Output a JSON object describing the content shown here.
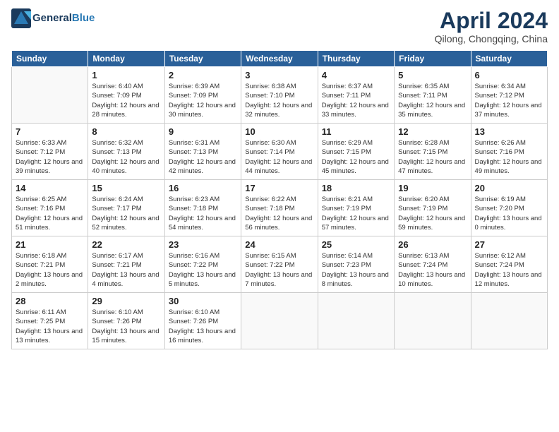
{
  "header": {
    "logo_line1": "General",
    "logo_line2": "Blue",
    "title": "April 2024",
    "subtitle": "Qilong, Chongqing, China"
  },
  "weekdays": [
    "Sunday",
    "Monday",
    "Tuesday",
    "Wednesday",
    "Thursday",
    "Friday",
    "Saturday"
  ],
  "weeks": [
    [
      {
        "day": "",
        "sunrise": "",
        "sunset": "",
        "daylight": ""
      },
      {
        "day": "1",
        "sunrise": "Sunrise: 6:40 AM",
        "sunset": "Sunset: 7:09 PM",
        "daylight": "Daylight: 12 hours and 28 minutes."
      },
      {
        "day": "2",
        "sunrise": "Sunrise: 6:39 AM",
        "sunset": "Sunset: 7:09 PM",
        "daylight": "Daylight: 12 hours and 30 minutes."
      },
      {
        "day": "3",
        "sunrise": "Sunrise: 6:38 AM",
        "sunset": "Sunset: 7:10 PM",
        "daylight": "Daylight: 12 hours and 32 minutes."
      },
      {
        "day": "4",
        "sunrise": "Sunrise: 6:37 AM",
        "sunset": "Sunset: 7:11 PM",
        "daylight": "Daylight: 12 hours and 33 minutes."
      },
      {
        "day": "5",
        "sunrise": "Sunrise: 6:35 AM",
        "sunset": "Sunset: 7:11 PM",
        "daylight": "Daylight: 12 hours and 35 minutes."
      },
      {
        "day": "6",
        "sunrise": "Sunrise: 6:34 AM",
        "sunset": "Sunset: 7:12 PM",
        "daylight": "Daylight: 12 hours and 37 minutes."
      }
    ],
    [
      {
        "day": "7",
        "sunrise": "Sunrise: 6:33 AM",
        "sunset": "Sunset: 7:12 PM",
        "daylight": "Daylight: 12 hours and 39 minutes."
      },
      {
        "day": "8",
        "sunrise": "Sunrise: 6:32 AM",
        "sunset": "Sunset: 7:13 PM",
        "daylight": "Daylight: 12 hours and 40 minutes."
      },
      {
        "day": "9",
        "sunrise": "Sunrise: 6:31 AM",
        "sunset": "Sunset: 7:13 PM",
        "daylight": "Daylight: 12 hours and 42 minutes."
      },
      {
        "day": "10",
        "sunrise": "Sunrise: 6:30 AM",
        "sunset": "Sunset: 7:14 PM",
        "daylight": "Daylight: 12 hours and 44 minutes."
      },
      {
        "day": "11",
        "sunrise": "Sunrise: 6:29 AM",
        "sunset": "Sunset: 7:15 PM",
        "daylight": "Daylight: 12 hours and 45 minutes."
      },
      {
        "day": "12",
        "sunrise": "Sunrise: 6:28 AM",
        "sunset": "Sunset: 7:15 PM",
        "daylight": "Daylight: 12 hours and 47 minutes."
      },
      {
        "day": "13",
        "sunrise": "Sunrise: 6:26 AM",
        "sunset": "Sunset: 7:16 PM",
        "daylight": "Daylight: 12 hours and 49 minutes."
      }
    ],
    [
      {
        "day": "14",
        "sunrise": "Sunrise: 6:25 AM",
        "sunset": "Sunset: 7:16 PM",
        "daylight": "Daylight: 12 hours and 51 minutes."
      },
      {
        "day": "15",
        "sunrise": "Sunrise: 6:24 AM",
        "sunset": "Sunset: 7:17 PM",
        "daylight": "Daylight: 12 hours and 52 minutes."
      },
      {
        "day": "16",
        "sunrise": "Sunrise: 6:23 AM",
        "sunset": "Sunset: 7:18 PM",
        "daylight": "Daylight: 12 hours and 54 minutes."
      },
      {
        "day": "17",
        "sunrise": "Sunrise: 6:22 AM",
        "sunset": "Sunset: 7:18 PM",
        "daylight": "Daylight: 12 hours and 56 minutes."
      },
      {
        "day": "18",
        "sunrise": "Sunrise: 6:21 AM",
        "sunset": "Sunset: 7:19 PM",
        "daylight": "Daylight: 12 hours and 57 minutes."
      },
      {
        "day": "19",
        "sunrise": "Sunrise: 6:20 AM",
        "sunset": "Sunset: 7:19 PM",
        "daylight": "Daylight: 12 hours and 59 minutes."
      },
      {
        "day": "20",
        "sunrise": "Sunrise: 6:19 AM",
        "sunset": "Sunset: 7:20 PM",
        "daylight": "Daylight: 13 hours and 0 minutes."
      }
    ],
    [
      {
        "day": "21",
        "sunrise": "Sunrise: 6:18 AM",
        "sunset": "Sunset: 7:21 PM",
        "daylight": "Daylight: 13 hours and 2 minutes."
      },
      {
        "day": "22",
        "sunrise": "Sunrise: 6:17 AM",
        "sunset": "Sunset: 7:21 PM",
        "daylight": "Daylight: 13 hours and 4 minutes."
      },
      {
        "day": "23",
        "sunrise": "Sunrise: 6:16 AM",
        "sunset": "Sunset: 7:22 PM",
        "daylight": "Daylight: 13 hours and 5 minutes."
      },
      {
        "day": "24",
        "sunrise": "Sunrise: 6:15 AM",
        "sunset": "Sunset: 7:22 PM",
        "daylight": "Daylight: 13 hours and 7 minutes."
      },
      {
        "day": "25",
        "sunrise": "Sunrise: 6:14 AM",
        "sunset": "Sunset: 7:23 PM",
        "daylight": "Daylight: 13 hours and 8 minutes."
      },
      {
        "day": "26",
        "sunrise": "Sunrise: 6:13 AM",
        "sunset": "Sunset: 7:24 PM",
        "daylight": "Daylight: 13 hours and 10 minutes."
      },
      {
        "day": "27",
        "sunrise": "Sunrise: 6:12 AM",
        "sunset": "Sunset: 7:24 PM",
        "daylight": "Daylight: 13 hours and 12 minutes."
      }
    ],
    [
      {
        "day": "28",
        "sunrise": "Sunrise: 6:11 AM",
        "sunset": "Sunset: 7:25 PM",
        "daylight": "Daylight: 13 hours and 13 minutes."
      },
      {
        "day": "29",
        "sunrise": "Sunrise: 6:10 AM",
        "sunset": "Sunset: 7:26 PM",
        "daylight": "Daylight: 13 hours and 15 minutes."
      },
      {
        "day": "30",
        "sunrise": "Sunrise: 6:10 AM",
        "sunset": "Sunset: 7:26 PM",
        "daylight": "Daylight: 13 hours and 16 minutes."
      },
      {
        "day": "",
        "sunrise": "",
        "sunset": "",
        "daylight": ""
      },
      {
        "day": "",
        "sunrise": "",
        "sunset": "",
        "daylight": ""
      },
      {
        "day": "",
        "sunrise": "",
        "sunset": "",
        "daylight": ""
      },
      {
        "day": "",
        "sunrise": "",
        "sunset": "",
        "daylight": ""
      }
    ]
  ]
}
